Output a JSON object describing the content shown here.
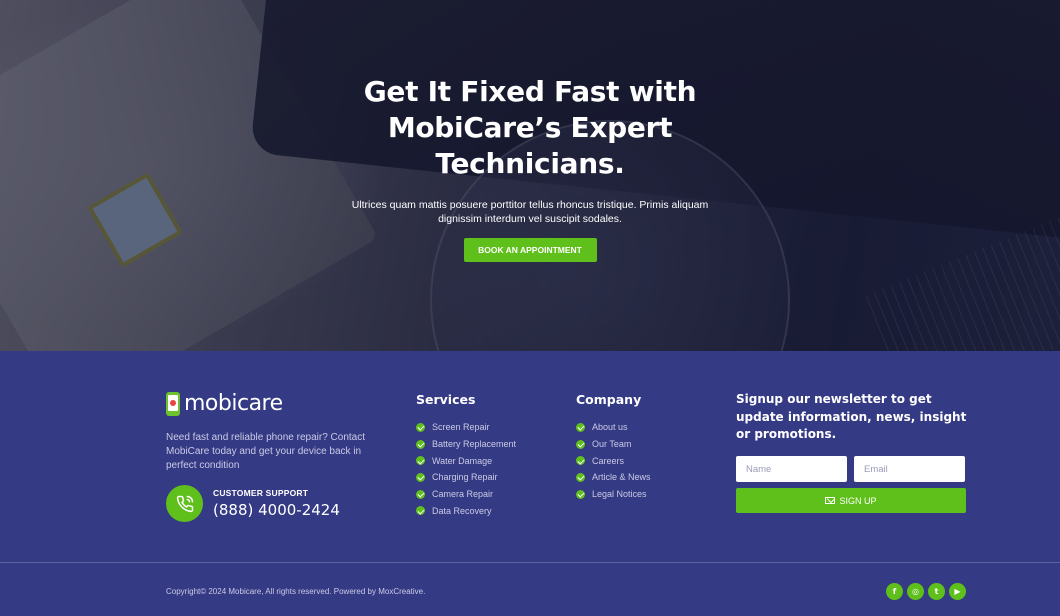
{
  "hero": {
    "title": "Get It Fixed Fast with MobiCare’s Expert Technicians.",
    "subtitle": "Ultrices quam mattis posuere porttitor tellus rhoncus tristique. Primis aliquam dignissim interdum vel suscipit sodales.",
    "cta_label": "BOOK AN APPOINTMENT"
  },
  "brand": {
    "name": "mobicare",
    "about": "Need fast and reliable phone repair? Contact MobiCare today and get your device back in perfect condition",
    "support_label": "CUSTOMER SUPPORT",
    "support_phone": "(888) 4000-2424",
    "support_icon": "phone-call-icon"
  },
  "services": {
    "title": "Services",
    "items": [
      "Screen Repair",
      "Battery Replacement",
      "Water Damage",
      "Charging Repair",
      "Camera Repair",
      "Data Recovery"
    ]
  },
  "company": {
    "title": "Company",
    "items": [
      "About us",
      "Our Team",
      "Careers",
      "Article & News",
      "Legal Notices"
    ]
  },
  "newsletter": {
    "title": "Signup our newsletter to get update information, news, insight or promotions.",
    "name_placeholder": "Name",
    "email_placeholder": "Email",
    "button_label": "SIGN UP",
    "button_icon": "mail-icon"
  },
  "bottom": {
    "copyright": "Copyright© 2024 Mobicare, All rights reserved. Powered by MoxCreative.",
    "socials": [
      {
        "icon": "facebook-icon",
        "glyph": "f"
      },
      {
        "icon": "instagram-icon",
        "glyph": "◎"
      },
      {
        "icon": "twitter-icon",
        "glyph": "t"
      },
      {
        "icon": "youtube-icon",
        "glyph": "▶"
      }
    ]
  },
  "colors": {
    "accent": "#5fbf1b",
    "footer_bg": "#353a85",
    "muted_text": "#c9cbe4"
  }
}
